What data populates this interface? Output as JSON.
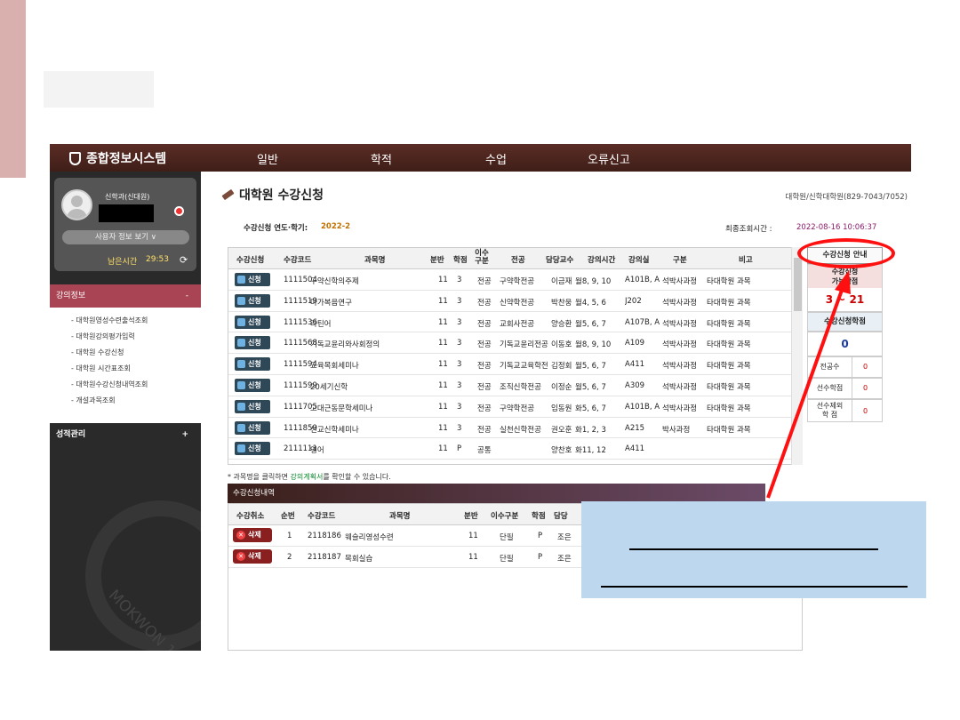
{
  "app": {
    "system_title": "종합정보시스템",
    "nav": [
      "일반",
      "학적",
      "수업",
      "오류신고"
    ]
  },
  "sidebar": {
    "user_dept": "신학과(신대원)",
    "userinfo_button": "사용자 정보 보기",
    "remaining_label": "남은시간",
    "remaining_time": "29:53",
    "menu_lecture": "강의정보",
    "menu_lecture_toggle": "-",
    "submenu": [
      "- 대학원영성수련출석조회",
      "- 대학원강의평가입력",
      "- 대학원 수강신청",
      "- 대학원 시간표조회",
      "- 대학원수강신청내역조회",
      "- 개설과목조회"
    ],
    "menu_grade": "성적관리",
    "menu_grade_toggle": "+",
    "watermark_text": "MOKWON 1954"
  },
  "main": {
    "title": "대학원 수강신청",
    "dept_info": "대학원/신학대학원(829-7043/7052)",
    "semester_label": "수강신청 연도·학기:",
    "semester_value": "2022-2",
    "last_query_label": "최종조회시간 :",
    "last_query_value": "2022-08-16 10:06:37",
    "table_headers": [
      "수강신청",
      "수강코드",
      "과목명",
      "분반",
      "학점",
      "이수\n구분",
      "전공",
      "담당교수",
      "강의시간",
      "강의실",
      "구분",
      "비고"
    ],
    "apply_label": "신청",
    "courses": [
      {
        "code": "1111504",
        "name": "구약신학의주제",
        "sec": "11",
        "cr": "3",
        "type": "전공",
        "major": "구약학전공",
        "prof": "이금재",
        "time": "월8, 9, 10",
        "room": "A101B, A",
        "div": "석박사과정",
        "note": "타대학원 과목"
      },
      {
        "code": "1111519",
        "name": "마가복음연구",
        "sec": "11",
        "cr": "3",
        "type": "전공",
        "major": "신약학전공",
        "prof": "박찬웅",
        "time": "월4, 5, 6",
        "room": "J202",
        "div": "석박사과정",
        "note": "타대학원 과목"
      },
      {
        "code": "1111536",
        "name": "라틴어",
        "sec": "11",
        "cr": "3",
        "type": "전공",
        "major": "교회사전공",
        "prof": "양승환",
        "time": "월5, 6, 7",
        "room": "A107B, A",
        "div": "석박사과정",
        "note": "타대학원 과목"
      },
      {
        "code": "1111568",
        "name": "기독교윤리와사회정의",
        "sec": "11",
        "cr": "3",
        "type": "전공",
        "major": "기독교윤리전공",
        "prof": "이동호",
        "time": "월8, 9, 10",
        "room": "A109",
        "div": "석박사과정",
        "note": "타대학원 과목"
      },
      {
        "code": "1111594",
        "name": "교육목회세미나",
        "sec": "11",
        "cr": "3",
        "type": "전공",
        "major": "기독교교육학전",
        "prof": "김정회",
        "time": "월5, 6, 7",
        "room": "A411",
        "div": "석박사과정",
        "note": "타대학원 과목"
      },
      {
        "code": "1111599",
        "name": "20세기신학",
        "sec": "11",
        "cr": "3",
        "type": "전공",
        "major": "조직신학전공",
        "prof": "이정순",
        "time": "월5, 6, 7",
        "room": "A309",
        "div": "석박사과정",
        "note": "타대학원 과목"
      },
      {
        "code": "1111705",
        "name": "고대근동문학세미나",
        "sec": "11",
        "cr": "3",
        "type": "전공",
        "major": "구약학전공",
        "prof": "임동원",
        "time": "화5, 6, 7",
        "room": "A101B, A",
        "div": "석박사과정",
        "note": "타대학원 과목"
      },
      {
        "code": "1111859",
        "name": "선교신학세미나",
        "sec": "11",
        "cr": "3",
        "type": "전공",
        "major": "실천신학전공",
        "prof": "권오훈",
        "time": "화1, 2, 3",
        "room": "A215",
        "div": "박사과정",
        "note": "타대학원 과목"
      },
      {
        "code": "2111111",
        "name": "영어",
        "sec": "11",
        "cr": "P",
        "type": "공통",
        "major": "",
        "prof": "양찬호",
        "time": "화11, 12",
        "room": "A411",
        "div": "",
        "note": ""
      }
    ],
    "note_pre": "* 과목명을 클릭하면 ",
    "note_link": "강의계획서",
    "note_post": "를 확인할 수 있습니다.",
    "history_title": "수강신청내역",
    "history_headers": [
      "수강취소",
      "순번",
      "수강코드",
      "과목명",
      "분반",
      "이수구분",
      "학점",
      "담당"
    ],
    "delete_label": "삭제",
    "history": [
      {
        "no": "1",
        "code": "2118186",
        "name": "웨슬리영성수련",
        "sec": "11",
        "type": "단필",
        "cr": "P",
        "prof": "조은"
      },
      {
        "no": "2",
        "code": "2118187",
        "name": "목회실습",
        "sec": "11",
        "type": "단필",
        "cr": "P",
        "prof": "조은"
      }
    ]
  },
  "right_panel": {
    "guide_button": "수강신청 안내",
    "possible_label_1": "수강신청",
    "possible_label_2": "가능학점",
    "possible_value": "3 ~ 21",
    "applied_label": "수강신청학점",
    "applied_value": "0",
    "major_label": "전공수",
    "major_value": "0",
    "prereq_label": "선수학점",
    "prereq_value": "0",
    "prereq_ex_label_1": "선수제외",
    "prereq_ex_label_2": "학 점",
    "prereq_ex_value": "0"
  },
  "colors": {
    "annotation": "#ff1010",
    "callout_bg": "#bdd7ee",
    "nav_bg": "#4a241d",
    "menu_active": "#a84453"
  }
}
